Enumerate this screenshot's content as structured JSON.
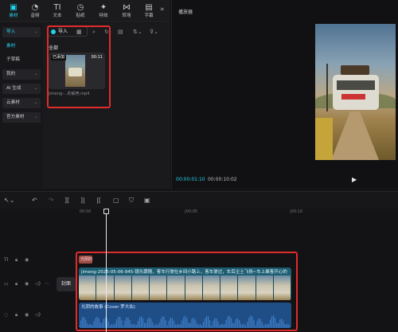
{
  "toolbar": {
    "items": [
      {
        "label": "素材",
        "icon": "media-icon"
      },
      {
        "label": "音频",
        "icon": "audio-icon"
      },
      {
        "label": "文本",
        "icon": "text-icon"
      },
      {
        "label": "贴纸",
        "icon": "sticker-icon"
      },
      {
        "label": "特效",
        "icon": "effects-icon"
      },
      {
        "label": "转场",
        "icon": "transition-icon"
      },
      {
        "label": "字幕",
        "icon": "captions-icon"
      }
    ],
    "more_label": "»"
  },
  "left_nav": {
    "items": [
      {
        "label": "导入",
        "caret": "⌄"
      },
      {
        "label": "素材",
        "caret": ""
      },
      {
        "label": "子草稿",
        "caret": ""
      },
      {
        "label": "我的",
        "caret": "⌄"
      },
      {
        "label": "AI 生成",
        "caret": "⌄"
      },
      {
        "label": "云素材",
        "caret": "⌄"
      },
      {
        "label": "官方素材",
        "caret": "⌄"
      }
    ]
  },
  "media": {
    "import_label": "导入",
    "all_label": "全部",
    "clip": {
      "added_badge": "已添加",
      "duration": "00:11",
      "filename": "jimeng-...的解壳.mp4"
    }
  },
  "player": {
    "title": "播放器",
    "current_time": "00:00:01:10",
    "total_time": "00:00:10:02"
  },
  "timeline": {
    "ruler_marks": [
      "00:00",
      "|00:05",
      "|00:10"
    ],
    "cover_label": "封面",
    "text_clip_label": "光阴的故事",
    "video_clip_label": "jimeng-2025-05-06-945-镜头跟随，客车行驶在乡间小路上，客车驶过，车后尘土飞扬~车上乘客开心的",
    "audio_clip_label": "光阴的故事 (Cover 罗大佑)"
  },
  "colors": {
    "accent": "#22d3ee",
    "highlight_box": "#e02b2b",
    "video_track": "#1d5e73",
    "audio_track": "#1f4e86",
    "text_track": "#a24d47"
  }
}
